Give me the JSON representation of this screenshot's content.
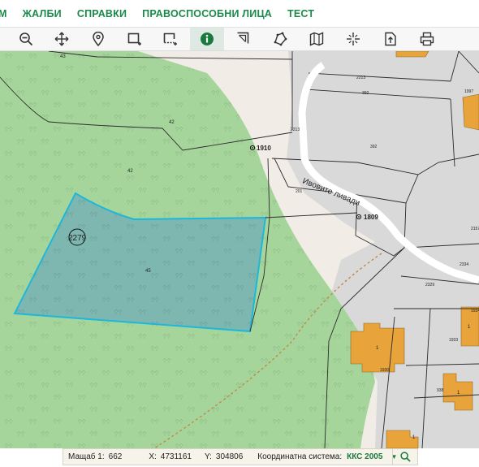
{
  "nav": {
    "items": [
      "М",
      "ЖАЛБИ",
      "СПРАВКИ",
      "ПРАВОСПОСОБНИ ЛИЦА",
      "ТЕСТ"
    ]
  },
  "toolbar": {
    "tools": [
      "zoom-out-icon",
      "pan-icon",
      "location-pin-icon",
      "select-rectangle-icon",
      "select-dashed-rectangle-icon",
      "info-icon",
      "measure-area-icon",
      "polygon-icon",
      "map-layers-icon",
      "crosshair-icon",
      "export-icon",
      "print-icon"
    ],
    "active_tool": "info-icon"
  },
  "map": {
    "colors": {
      "forest": "#a6d59c",
      "road": "#f1ece6",
      "urban": "#d9d9d9",
      "building": "#e8a33a",
      "selection_fill": "#7ab4b3",
      "selection_stroke": "#1db7dc"
    },
    "labels": {
      "parcel_43": "43",
      "parcel_42a": "42",
      "parcel_42b": "42",
      "parcel_45": "45",
      "parcel_2279": "2279",
      "point_1910": "1910",
      "point_1809": "1809",
      "street": "Ивовите ливади",
      "p2213a": "2213",
      "p2213b": "2213",
      "p392a": "392",
      "p392b": "392",
      "p201": "201",
      "p1997": "1997",
      "p2157": "2157",
      "p2334": "2334",
      "p2329": "2329",
      "p1934": "1934",
      "p1933": "1933",
      "p1930": "1930",
      "p938": "938",
      "b1a": "1",
      "b1b": "1",
      "b1c": "1",
      "b1d": "1"
    }
  },
  "statusbar": {
    "scale_label": "Мащаб 1:",
    "scale_value": "662",
    "x_label": "X:",
    "x_value": "4731161",
    "y_label": "Y:",
    "y_value": "304806",
    "crs_label": "Координатна система:",
    "crs_value": "ККС 2005"
  }
}
